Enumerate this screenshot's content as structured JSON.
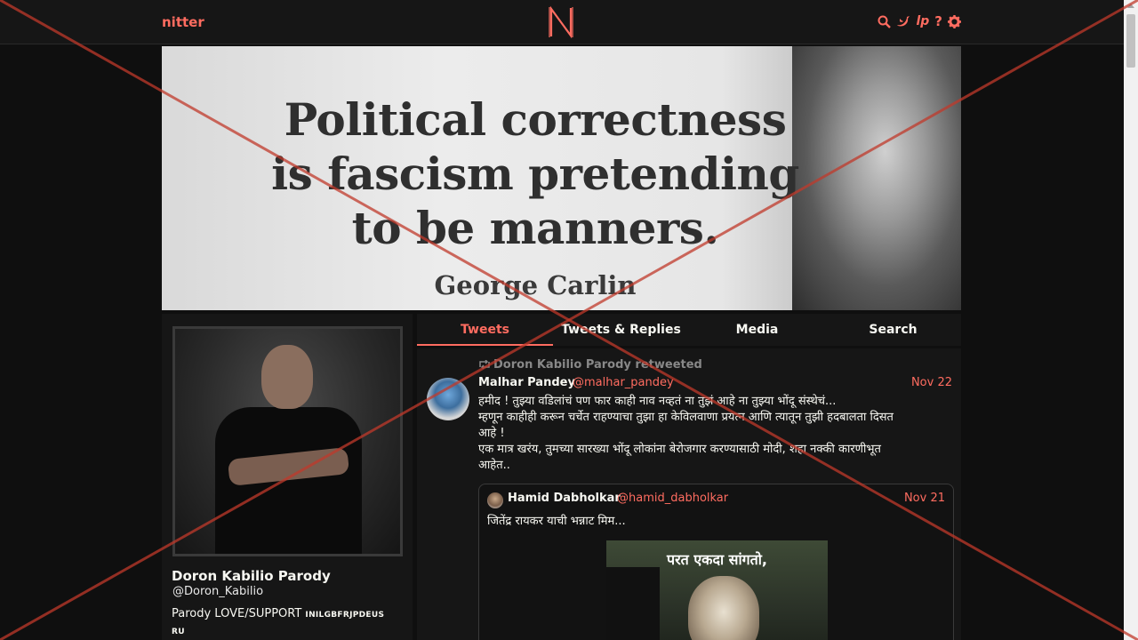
{
  "navbar": {
    "brand": "nitter",
    "logo_letter": "N",
    "icons": [
      "search-icon",
      "twitter-bird-icon",
      "rss-icon",
      "help-icon",
      "gear-icon"
    ],
    "help_glyph": "?",
    "rss_glyph": "lp"
  },
  "banner": {
    "quote": "Political correctness is fascism pretending to be manners.",
    "author": "George Carlin"
  },
  "profile": {
    "name": "Doron Kabilio Parody",
    "handle": "@Doron_Kabilio",
    "bio_main": "Parody LOVE/SUPPORT ",
    "bio_small_1": "INILGBFRJPDEUS",
    "bio_small_2": "RU"
  },
  "tabs": [
    "Tweets",
    "Tweets & Replies",
    "Media",
    "Search"
  ],
  "active_tab": "Tweets",
  "tweet": {
    "retweet_label": "Doron Kabilio Parody retweeted",
    "author_name": "Malhar Pandey",
    "author_handle": "@malhar_pandey",
    "date": "Nov 22",
    "body": "हमीद ! तुझ्या वडिलांचं पण फार काही नाव नव्हतं ना तुझं आहे ना तुझ्या भोंदू संस्थेचं...\nम्हणून काहीही करून चर्चेत राहण्याचा तुझा हा केविलवाणा प्रयत्न आणि त्यातून तुझी हदबालता दिसत\nआहे !\nएक मात्र खरंय, तुमच्या सारख्या भोंदू लोकांना बेरोजगार करण्यासाठी मोदी, शहा नक्की कारणीभूत\nआहेत..",
    "quote": {
      "author_name": "Hamid Dabholkar",
      "author_handle": "@hamid_dabholkar",
      "date": "Nov 21",
      "body": "जितेंद्र रायकर याची भन्नाट मिम...",
      "media_caption": "परत एकदा सांगतो,"
    }
  },
  "colors": {
    "accent": "#ff6c60",
    "background": "#0f0f0f",
    "panel": "#161616",
    "overlay_x": "#c0392b"
  }
}
